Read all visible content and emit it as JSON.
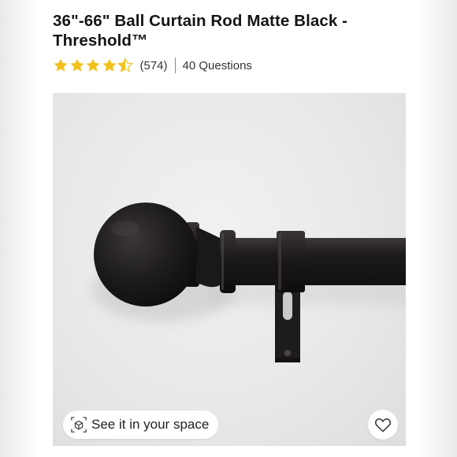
{
  "product": {
    "title": "36\"-66\" Ball Curtain Rod Matte Black - Threshold™",
    "rating": {
      "stars": 4.5,
      "max": 5,
      "count_label": "(574)"
    },
    "questions_label": "40 Questions"
  },
  "image": {
    "see_in_space_label": "See it in your space",
    "icons": {
      "ar": "ar-cube-icon",
      "favorite": "heart-outline-icon"
    }
  },
  "colors": {
    "star": "#f3c11b",
    "star_empty": "#ffffff"
  }
}
